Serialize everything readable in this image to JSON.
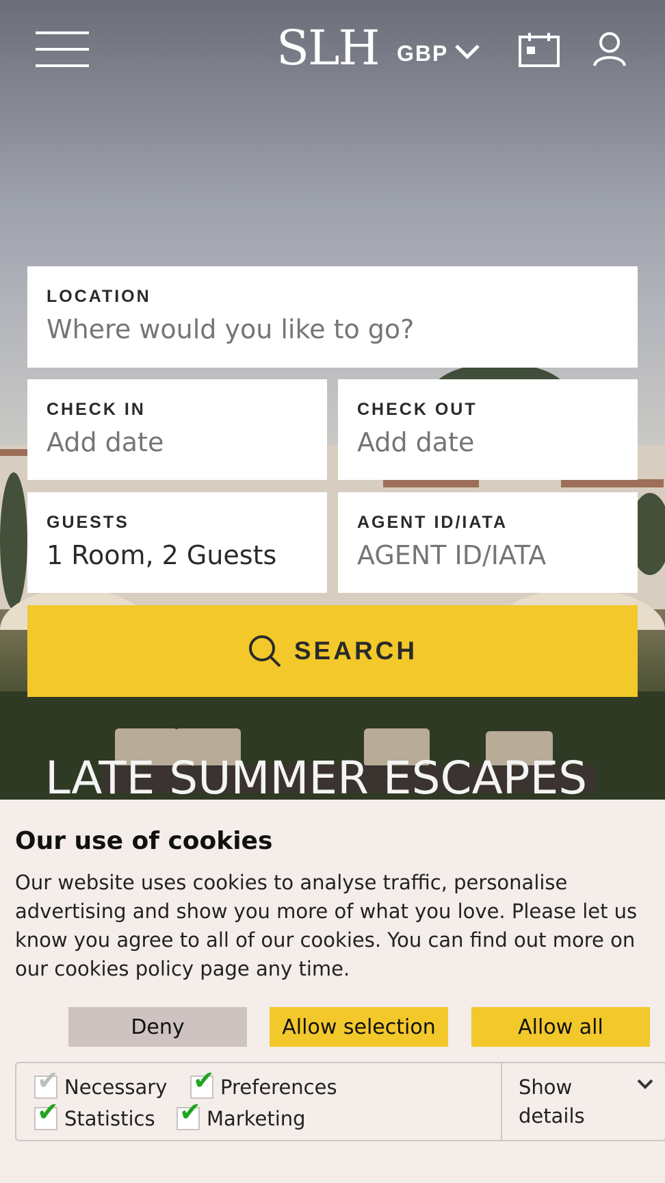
{
  "header": {
    "logo": "SLH",
    "currency": "GBP"
  },
  "search_form": {
    "location": {
      "label": "LOCATION",
      "placeholder": "Where would you like to go?"
    },
    "check_in": {
      "label": "CHECK IN",
      "placeholder": "Add date"
    },
    "check_out": {
      "label": "CHECK OUT",
      "placeholder": "Add date"
    },
    "guests": {
      "label": "GUESTS",
      "value": "1 Room, 2 Guests"
    },
    "agent": {
      "label": "AGENT ID/IATA",
      "placeholder": "AGENT ID/IATA"
    },
    "search_label": "SEARCH"
  },
  "hero": {
    "headline": "LATE SUMMER ESCAPES"
  },
  "cookie_banner": {
    "title": "Our use of cookies",
    "body": "Our website uses cookies to analyse traffic, personalise advertising and show you more of what you love. Please let us know you agree to all of our cookies. You can find out more on our cookies policy page any time.",
    "buttons": {
      "deny": "Deny",
      "allow_selection": "Allow selection",
      "allow_all": "Allow all"
    },
    "preferences": [
      {
        "label": "Necessary",
        "checked": true,
        "disabled": true
      },
      {
        "label": "Preferences",
        "checked": true,
        "disabled": false
      },
      {
        "label": "Statistics",
        "checked": true,
        "disabled": false
      },
      {
        "label": "Marketing",
        "checked": true,
        "disabled": false
      }
    ],
    "show_details": "Show details"
  },
  "colors": {
    "accent": "#f2c82b",
    "deny_bg": "#cfc3c1",
    "banner_bg": "#f4edea",
    "check": "#1fa51f"
  }
}
